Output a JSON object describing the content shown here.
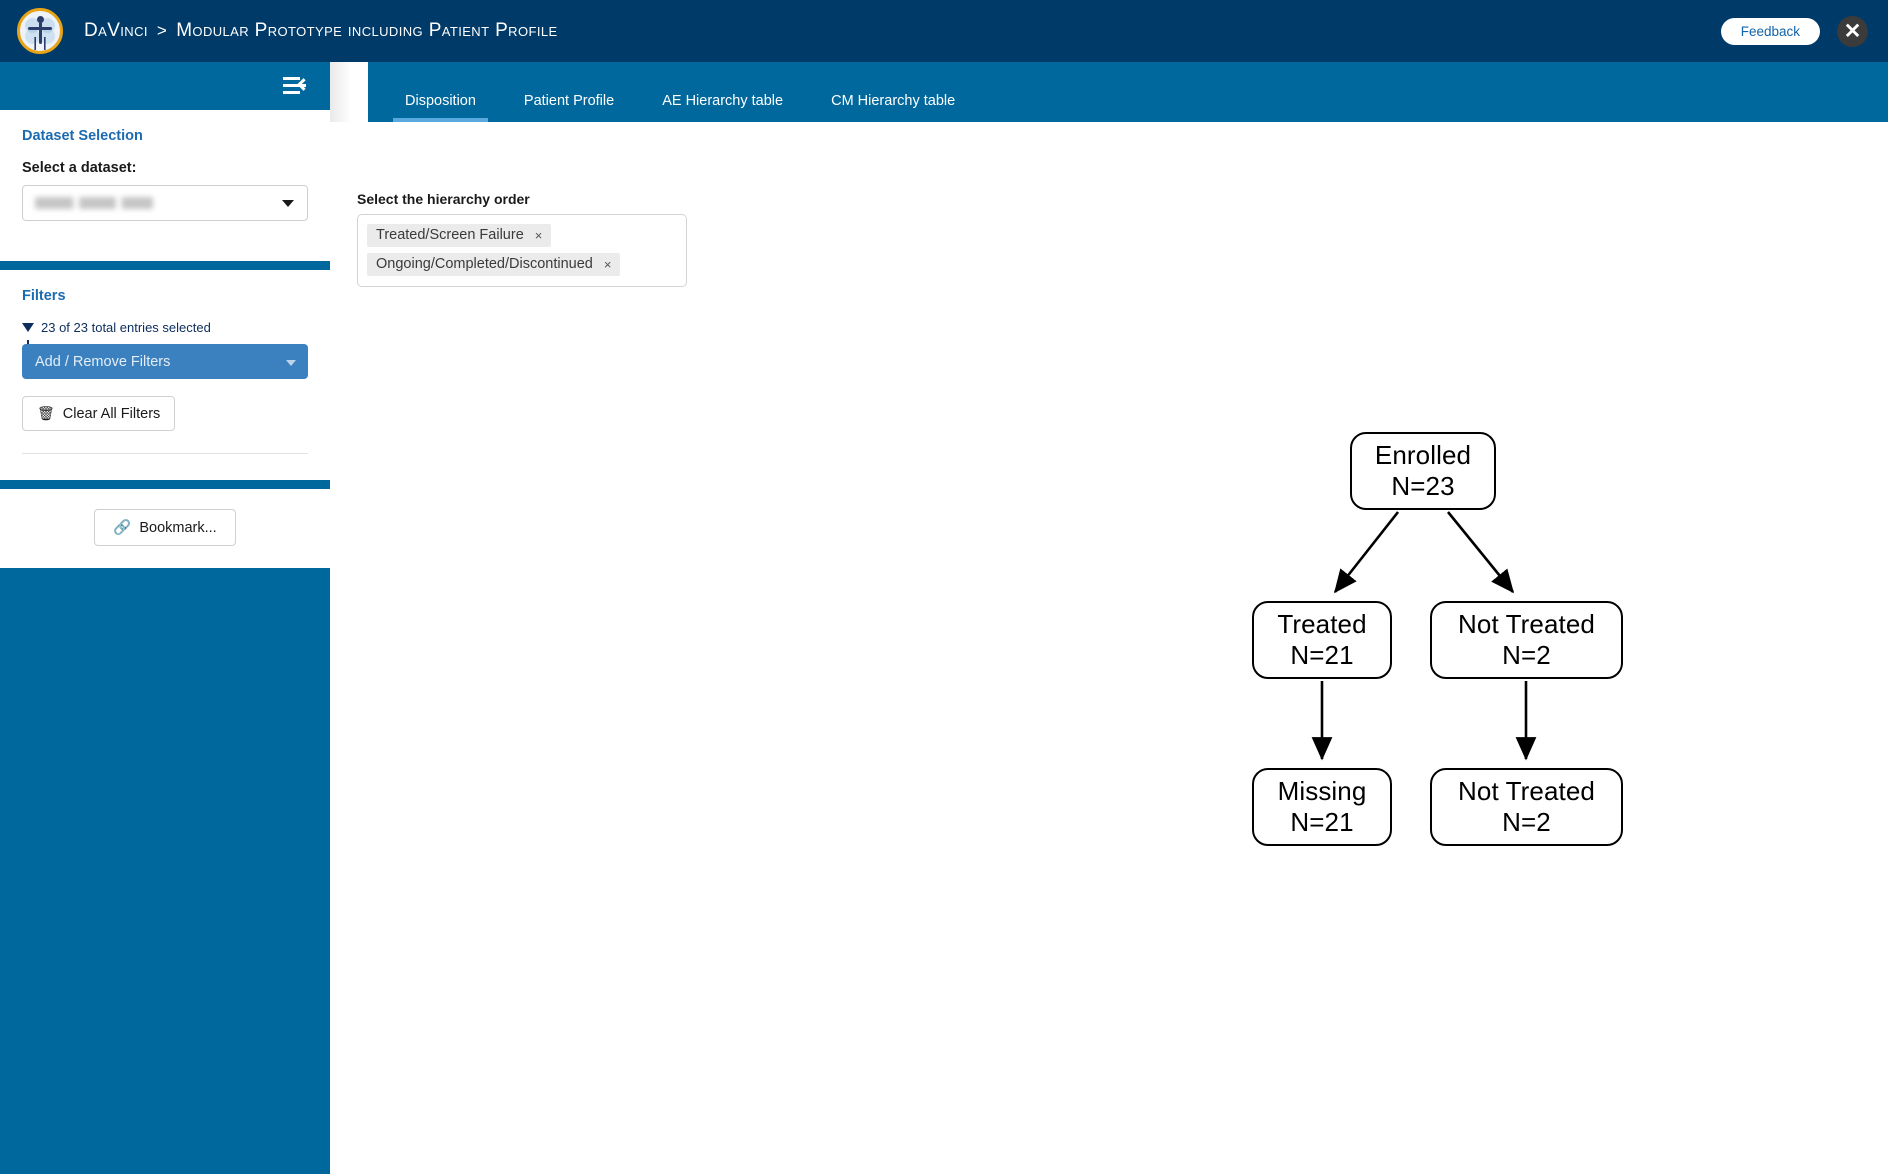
{
  "header": {
    "logo_icon": "davinci-human-figure-logo",
    "breadcrumb_root": "DaVinci",
    "breadcrumb_separator": ">",
    "breadcrumb_current": "Modular Prototype including Patient Profile",
    "feedback_label": "Feedback",
    "close_icon": "✖",
    "background_color": "#003a69",
    "feedback_text_color": "#1363a8"
  },
  "sidebar": {
    "background_color": "#00689c",
    "collapse_icon": "collapse-sidebar-icon",
    "dataset_panel": {
      "title": "Dataset Selection",
      "select_label": "Select a dataset:",
      "selected_value": "",
      "value_redacted": true,
      "caret_icon": "chevron-down-icon"
    },
    "filters_panel": {
      "title": "Filters",
      "funnel_icon": "funnel-icon",
      "entries_selected_text": "23 of 23 total entries selected",
      "add_remove_label": "Add / Remove Filters",
      "add_remove_color": "#3c81bf",
      "clear_all_label": "Clear All Filters",
      "trash_icon": "🗑"
    },
    "bookmark_panel": {
      "bookmark_label": "Bookmark...",
      "link_icon": "🔗"
    }
  },
  "tabs": {
    "active_index": 0,
    "active_underline_color": "#5aa9de",
    "items": [
      {
        "label": "Disposition"
      },
      {
        "label": "Patient Profile"
      },
      {
        "label": "AE Hierarchy table"
      },
      {
        "label": "CM Hierarchy table"
      }
    ]
  },
  "main": {
    "hierarchy_label": "Select the hierarchy order",
    "hierarchy_tags": [
      {
        "label": "Treated/Screen Failure",
        "remove_icon": "×"
      },
      {
        "label": "Ongoing/Completed/Discontinued",
        "remove_icon": "×"
      }
    ]
  },
  "chart_data": {
    "type": "diagram",
    "diagram_kind": "disposition-flowchart",
    "title": "",
    "nodes": [
      {
        "id": "enrolled",
        "label": "Enrolled",
        "count_label": "N=23",
        "n": 23,
        "level": 0
      },
      {
        "id": "treated",
        "label": "Treated",
        "count_label": "N=21",
        "n": 21,
        "level": 1
      },
      {
        "id": "not_treated",
        "label": "Not Treated",
        "count_label": "N=2",
        "n": 2,
        "level": 1
      },
      {
        "id": "missing",
        "label": "Missing",
        "count_label": "N=21",
        "n": 21,
        "level": 2
      },
      {
        "id": "not_treated2",
        "label": "Not Treated",
        "count_label": "N=2",
        "n": 2,
        "level": 2
      }
    ],
    "edges": [
      {
        "from": "enrolled",
        "to": "treated"
      },
      {
        "from": "enrolled",
        "to": "not_treated"
      },
      {
        "from": "treated",
        "to": "missing"
      },
      {
        "from": "not_treated",
        "to": "not_treated2"
      }
    ],
    "node_shape": "rounded-rectangle",
    "node_border_color": "#000000",
    "node_fill_color": "#ffffff",
    "edge_color": "#000000",
    "edge_style": "solid-arrow"
  }
}
